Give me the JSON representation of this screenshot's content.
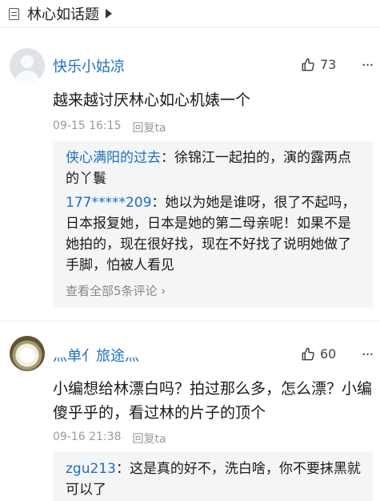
{
  "topic": {
    "title": "林心如话题"
  },
  "comments": [
    {
      "username": "快乐小姑凉",
      "likes": "73",
      "text": "越来越讨厌林心如心机婊一个",
      "time": "09-15 16:15",
      "reply_label": "回复ta",
      "replies": [
        {
          "name": "侠心满阳的过去",
          "text": "徐锦江一起拍的，演的露两点的丫鬟"
        },
        {
          "name": "177*****209",
          "text": "她以为她是谁呀，很了不起吗，日本报复她，日本是她的第二母亲呢！如果不是她拍的，现在很好找，现在不好找了说明她做了手脚，怕被人看见"
        }
      ],
      "view_all": "查看全部5条评论 ›"
    },
    {
      "username": "灬单亻旅途灬",
      "likes": "60",
      "text": "小编想给林漂白吗？拍过那么多，怎么漂？小编傻乎乎的，看过林的片子的顶个",
      "time": "09-16 21:38",
      "reply_label": "回复ta",
      "replies": [
        {
          "name": "zgu213",
          "text": "这是真的好不，洗白啥，你不要抹黑就可以了"
        }
      ]
    }
  ],
  "icons": {
    "topic": "topic-doc-icon",
    "like": "thumbs-up-icon",
    "more": "more-dots-icon"
  },
  "colors": {
    "username": "#1e6fbf",
    "meta": "#999999",
    "reply_bg": "#f4f5f6"
  }
}
